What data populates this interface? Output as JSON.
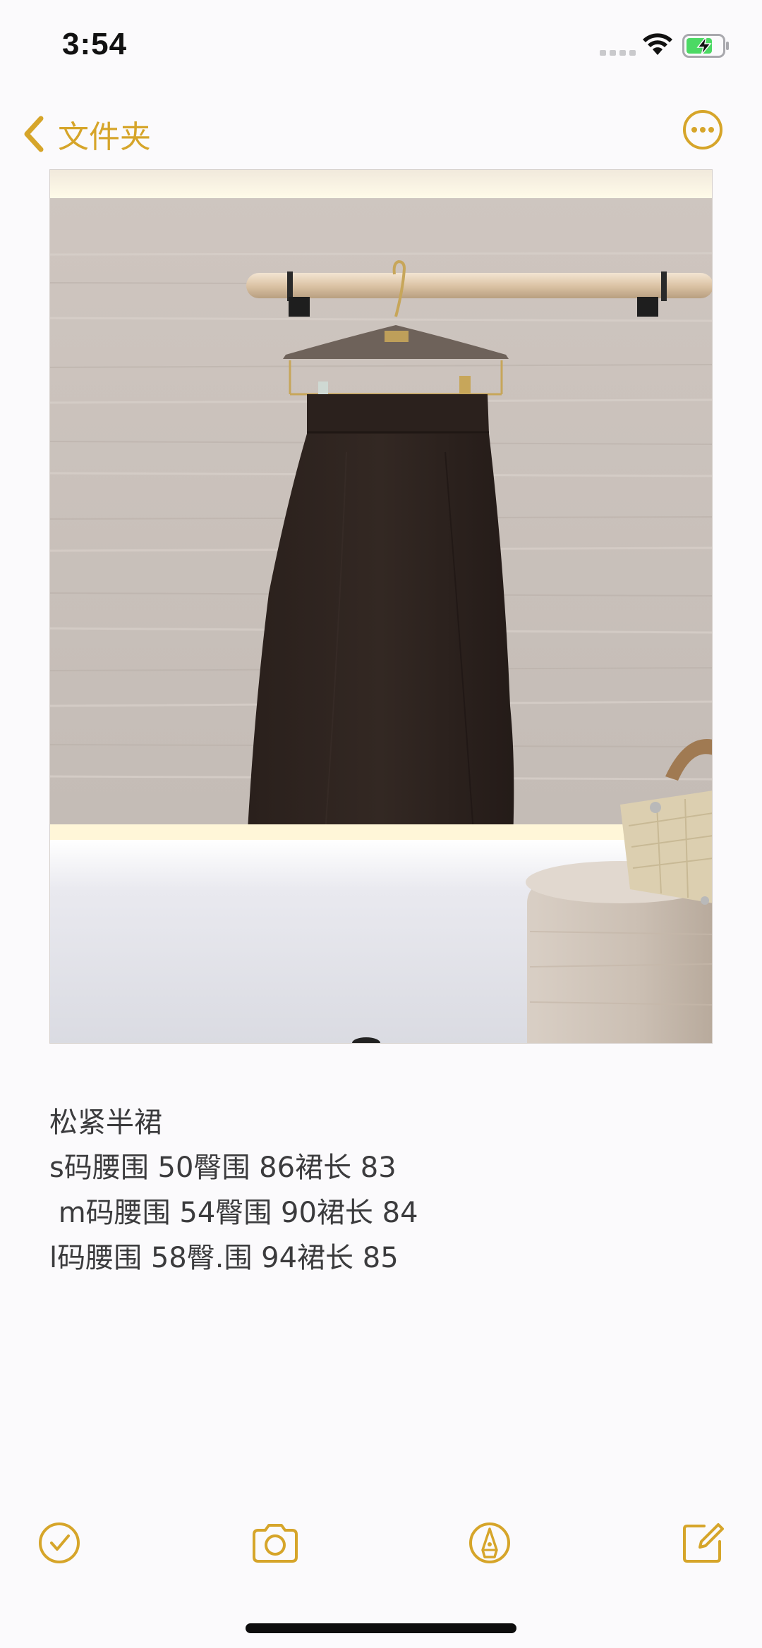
{
  "status_bar": {
    "time": "3:54",
    "icons": [
      "signal-icon",
      "wifi-icon",
      "battery-charging-icon"
    ]
  },
  "nav": {
    "back_label": "文件夹",
    "back_icon": "chevron-left-icon",
    "more_icon": "ellipsis-circle-icon"
  },
  "note": {
    "lines": [
      "松紧半裙",
      "s码腰围 50臀围 86裙长 83",
      " m码腰围 54臀围 90裙长 84",
      "l码腰围 58臀.围 94裙长 85"
    ]
  },
  "toolbar": {
    "items": [
      "checklist-icon",
      "camera-icon",
      "markup-pen-icon",
      "compose-icon"
    ]
  },
  "colors": {
    "accent": "#d6a52a",
    "background": "#fbfafc",
    "text": "#3b3b3d"
  }
}
